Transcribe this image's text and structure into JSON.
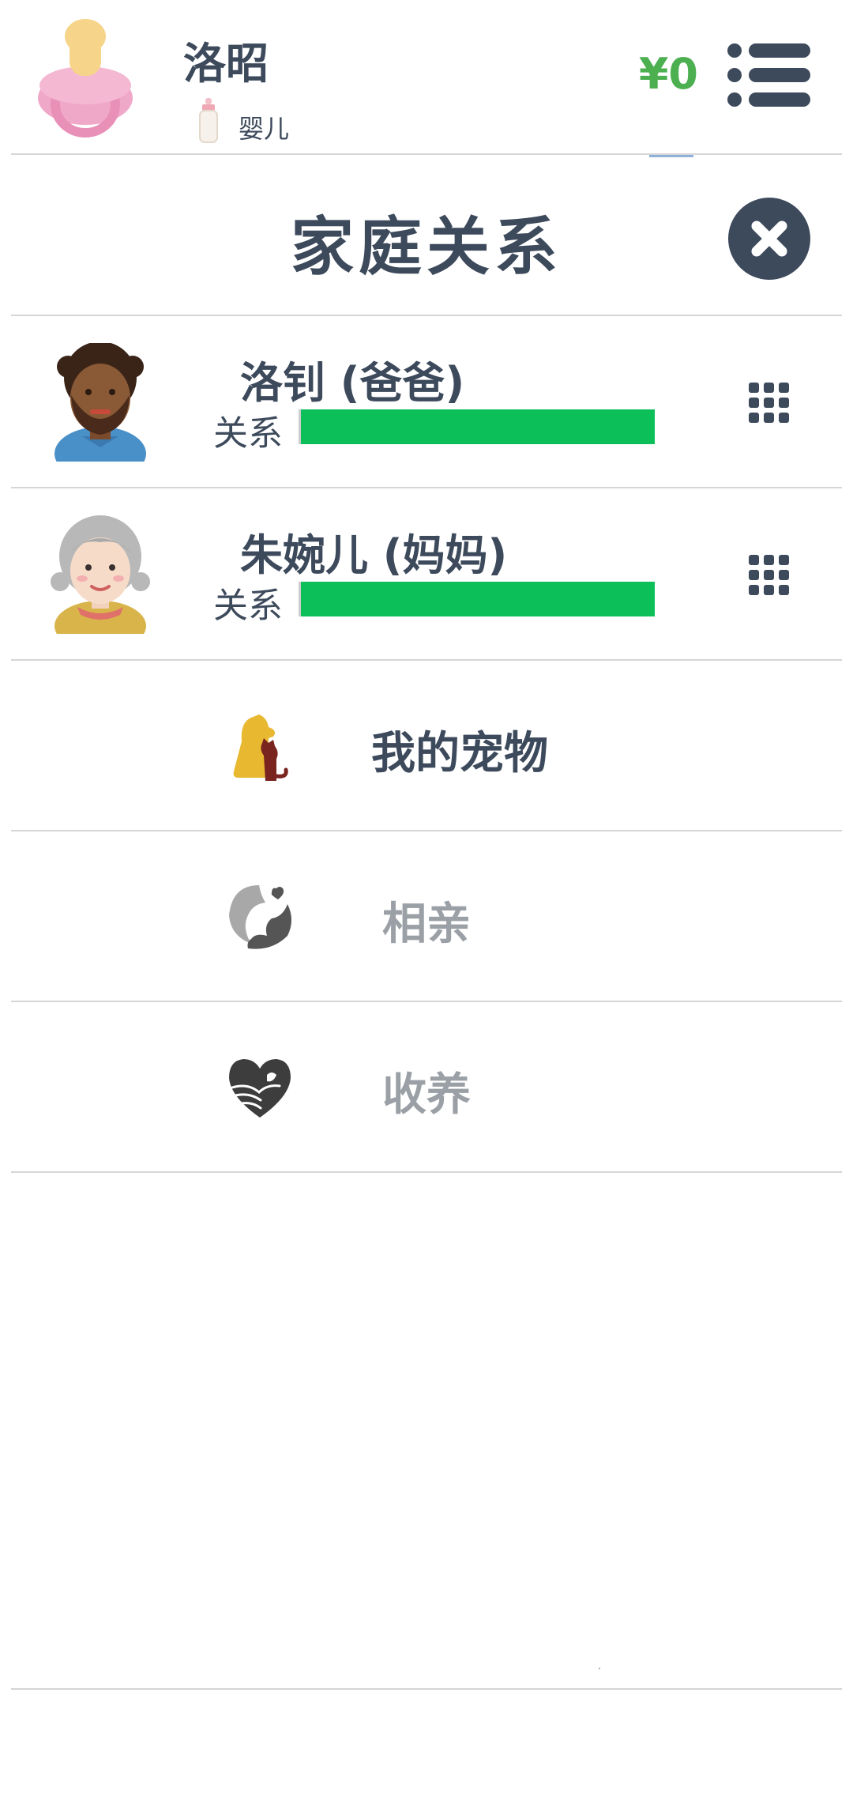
{
  "header": {
    "name": "洛昭",
    "stage": "婴儿",
    "money": "¥0",
    "avatar_icon": "pacifier-icon",
    "stage_icon": "baby-bottle-icon",
    "menu_icon": "list-menu-icon"
  },
  "dialog": {
    "title": "家庭关系",
    "close_icon": "close-icon"
  },
  "members": [
    {
      "name": "洛钊 (爸爸)",
      "relation_label": "关系",
      "relation_level": 1.0,
      "avatar_icon": "father-avatar-icon"
    },
    {
      "name": "朱婉儿 (妈妈)",
      "relation_label": "关系",
      "relation_level": 1.0,
      "avatar_icon": "mother-avatar-icon"
    }
  ],
  "actions": [
    {
      "label": "我的宠物",
      "icon": "pet-icon",
      "enabled": true
    },
    {
      "label": "相亲",
      "icon": "dating-icon",
      "enabled": false
    },
    {
      "label": "收养",
      "icon": "adopt-heart-icon",
      "enabled": false
    }
  ],
  "colors": {
    "text": "#3d4a5c",
    "money": "#4caf50",
    "bar": "#0cbf58",
    "disabled": "#9aa0a6"
  }
}
